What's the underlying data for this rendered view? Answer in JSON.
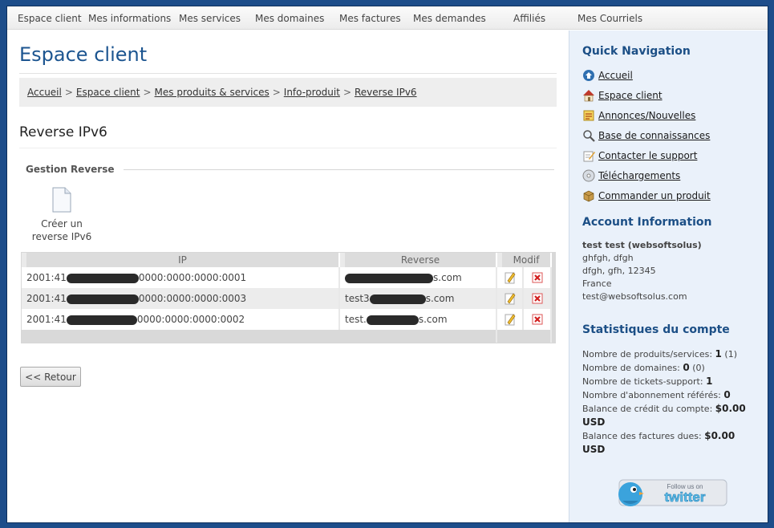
{
  "nav": [
    "Espace client",
    "Mes informations",
    "Mes services",
    "Mes domaines",
    "Mes factures",
    "Mes demandes",
    "Affiliés",
    "Mes Courriels"
  ],
  "page_title": "Espace client",
  "breadcrumb": [
    "Accueil",
    "Espace client",
    "Mes produits & services",
    "Info-produit",
    "Reverse IPv6"
  ],
  "breadcrumb_sep": ">",
  "section_title": "Reverse IPv6",
  "fieldset_legend": "Gestion Reverse",
  "create_label_1": "Créer un",
  "create_label_2": "reverse IPv6",
  "table": {
    "headers": [
      "IP",
      "Reverse",
      "Modif"
    ],
    "rows": [
      {
        "ip_prefix": "2001:41",
        "ip_suffix": "0000:0000:0000:0001",
        "rev_prefix": "",
        "rev_suffix": "s.com"
      },
      {
        "ip_prefix": "2001:41",
        "ip_suffix": "0000:0000:0000:0003",
        "rev_prefix": "test3",
        "rev_suffix": "s.com"
      },
      {
        "ip_prefix": "2001:41",
        "ip_suffix": "0000:0000:0000:0002",
        "rev_prefix": "test.",
        "rev_suffix": "s.com"
      }
    ]
  },
  "back_button": "<< Retour",
  "sidebar": {
    "quick_nav_title": "Quick Navigation",
    "quick_nav": [
      {
        "label": "Accueil",
        "icon": "home-globe-icon"
      },
      {
        "label": "Espace client",
        "icon": "house-icon"
      },
      {
        "label": "Annonces/Nouvelles",
        "icon": "news-icon"
      },
      {
        "label": "Base de connaissances",
        "icon": "magnifier-icon"
      },
      {
        "label": "Contacter le support",
        "icon": "edit-note-icon"
      },
      {
        "label": "Téléchargements",
        "icon": "disc-icon"
      },
      {
        "label": "Commander un produit",
        "icon": "box-icon"
      }
    ],
    "account_title": "Account Information",
    "account_name": "test test (websoftsolus)",
    "account_lines": [
      "ghfgh, dfgh",
      "dfgh, gfh, 12345",
      "France",
      "test@websoftsolus.com"
    ],
    "stats_title": "Statistiques du compte",
    "stats": [
      {
        "label": "Nombre de produits/services:",
        "value": "1",
        "extra": "(1)"
      },
      {
        "label": "Nombre de domaines:",
        "value": "0",
        "extra": "(0)"
      },
      {
        "label": "Nombre de tickets-support:",
        "value": "1",
        "extra": ""
      },
      {
        "label": "Nombre d'abonnement référés:",
        "value": "0",
        "extra": ""
      },
      {
        "label": "Balance de crédit du compte:",
        "value": "$0.00",
        "extra": "USD"
      },
      {
        "label": "Balance des factures dues:",
        "value": "$0.00",
        "extra": "USD"
      }
    ],
    "twitter_top": "Follow us on",
    "twitter_main": "twitter"
  }
}
